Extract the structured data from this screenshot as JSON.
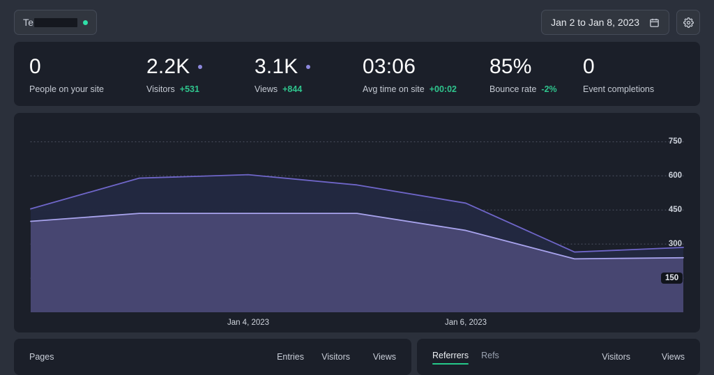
{
  "topbar": {
    "site_name_visible": "Te",
    "site_redacted": true,
    "status_dot_color": "#2fe0a8",
    "date_range": "Jan 2 to Jan 8, 2023",
    "calendar_icon": "calendar-icon",
    "settings_icon": "gear-icon"
  },
  "stats": [
    {
      "value": "0",
      "label": "People on your site",
      "delta": "",
      "dot": false
    },
    {
      "value": "2.2K",
      "label": "Visitors",
      "delta": "+531",
      "dot": true
    },
    {
      "value": "3.1K",
      "label": "Views",
      "delta": "+844",
      "dot": true
    },
    {
      "value": "03:06",
      "label": "Avg time on site",
      "delta": "+00:02",
      "dot": false
    },
    {
      "value": "85%",
      "label": "Bounce rate",
      "delta": "-2%",
      "dot": false
    },
    {
      "value": "0",
      "label": "Event completions",
      "delta": "",
      "dot": false
    }
  ],
  "chart_data": {
    "type": "area",
    "title": "",
    "xlabel": "",
    "ylabel": "",
    "grid": true,
    "legend_position": "stats-row",
    "ylim": [
      0,
      840
    ],
    "yticks": [
      150,
      300,
      450,
      600,
      750
    ],
    "ytick_labels": [
      "150",
      "300",
      "450",
      "600",
      "750"
    ],
    "x": [
      "Jan 2, 2023",
      "Jan 3, 2023",
      "Jan 4, 2023",
      "Jan 5, 2023",
      "Jan 6, 2023",
      "Jan 7, 2023",
      "Jan 8, 2023"
    ],
    "xtick_labels": [
      "Jan 4, 2023",
      "Jan 6, 2023"
    ],
    "xtick_indices": [
      2,
      4
    ],
    "series": [
      {
        "name": "Views",
        "color": "#6f66c9",
        "fill": "#232941",
        "values": [
          455,
          590,
          605,
          560,
          480,
          265,
          285
        ]
      },
      {
        "name": "Visitors",
        "color": "#a9a4ee",
        "fill": "#4a4874",
        "values": [
          400,
          435,
          435,
          435,
          360,
          235,
          240
        ]
      }
    ]
  },
  "panels": {
    "left": {
      "title": "Pages",
      "columns": [
        "Entries",
        "Visitors",
        "Views"
      ]
    },
    "right": {
      "tabs": [
        {
          "label": "Referrers",
          "active": true
        },
        {
          "label": "Refs",
          "active": false
        }
      ],
      "columns": [
        "Visitors",
        "Views"
      ]
    }
  }
}
